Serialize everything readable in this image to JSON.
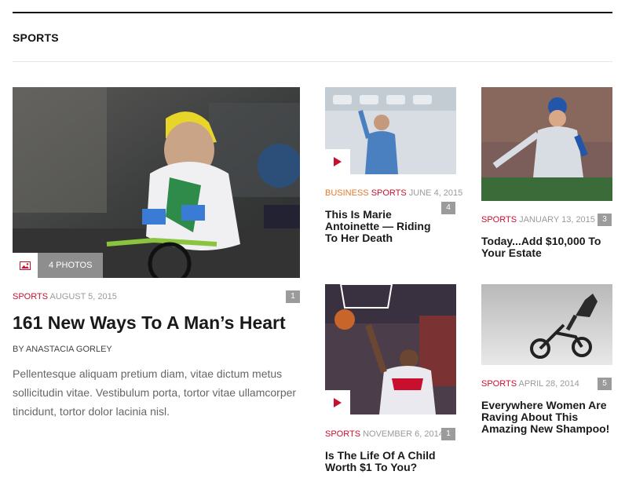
{
  "section": {
    "title": "SPORTS"
  },
  "featured": {
    "photo_label": "4 PHOTOS",
    "category": "SPORTS",
    "date": "AUGUST 5, 2015",
    "count": "1",
    "title": "161 New Ways To A Man’s Heart",
    "byline": "BY ANASTACIA GORLEY",
    "excerpt": "Pellentesque aliquam pretium diam, vitae dictum metus sollicitudin vitae. Vestibulum porta, tortor vitae ullamcorper tincidunt, tortor dolor lacinia nisl."
  },
  "cards": [
    {
      "category_1": "BUSINESS",
      "category_2": "SPORTS",
      "date": "JUNE 4, 2015",
      "count": "4",
      "title": "This Is Marie Antoinette — Riding To Her Death"
    },
    {
      "category": "SPORTS",
      "date": "JANUARY 13, 2015",
      "count": "3",
      "title": "Today...Add $10,000 To Your Estate"
    },
    {
      "category": "SPORTS",
      "date": "NOVEMBER 6, 2014",
      "count": "1",
      "title": "Is The Life Of A Child Worth $1 To You?"
    },
    {
      "category": "SPORTS",
      "date": "APRIL 28, 2014",
      "count": "5",
      "title": "Everywhere Women Are Raving About This Amazing New Shampoo!"
    }
  ],
  "colors": {
    "accent": "#c8102e",
    "business": "#e07a2c",
    "meta": "#9a9a9a",
    "badge": "#9b9b9b"
  },
  "icons": [
    "image-icon",
    "play-icon"
  ]
}
